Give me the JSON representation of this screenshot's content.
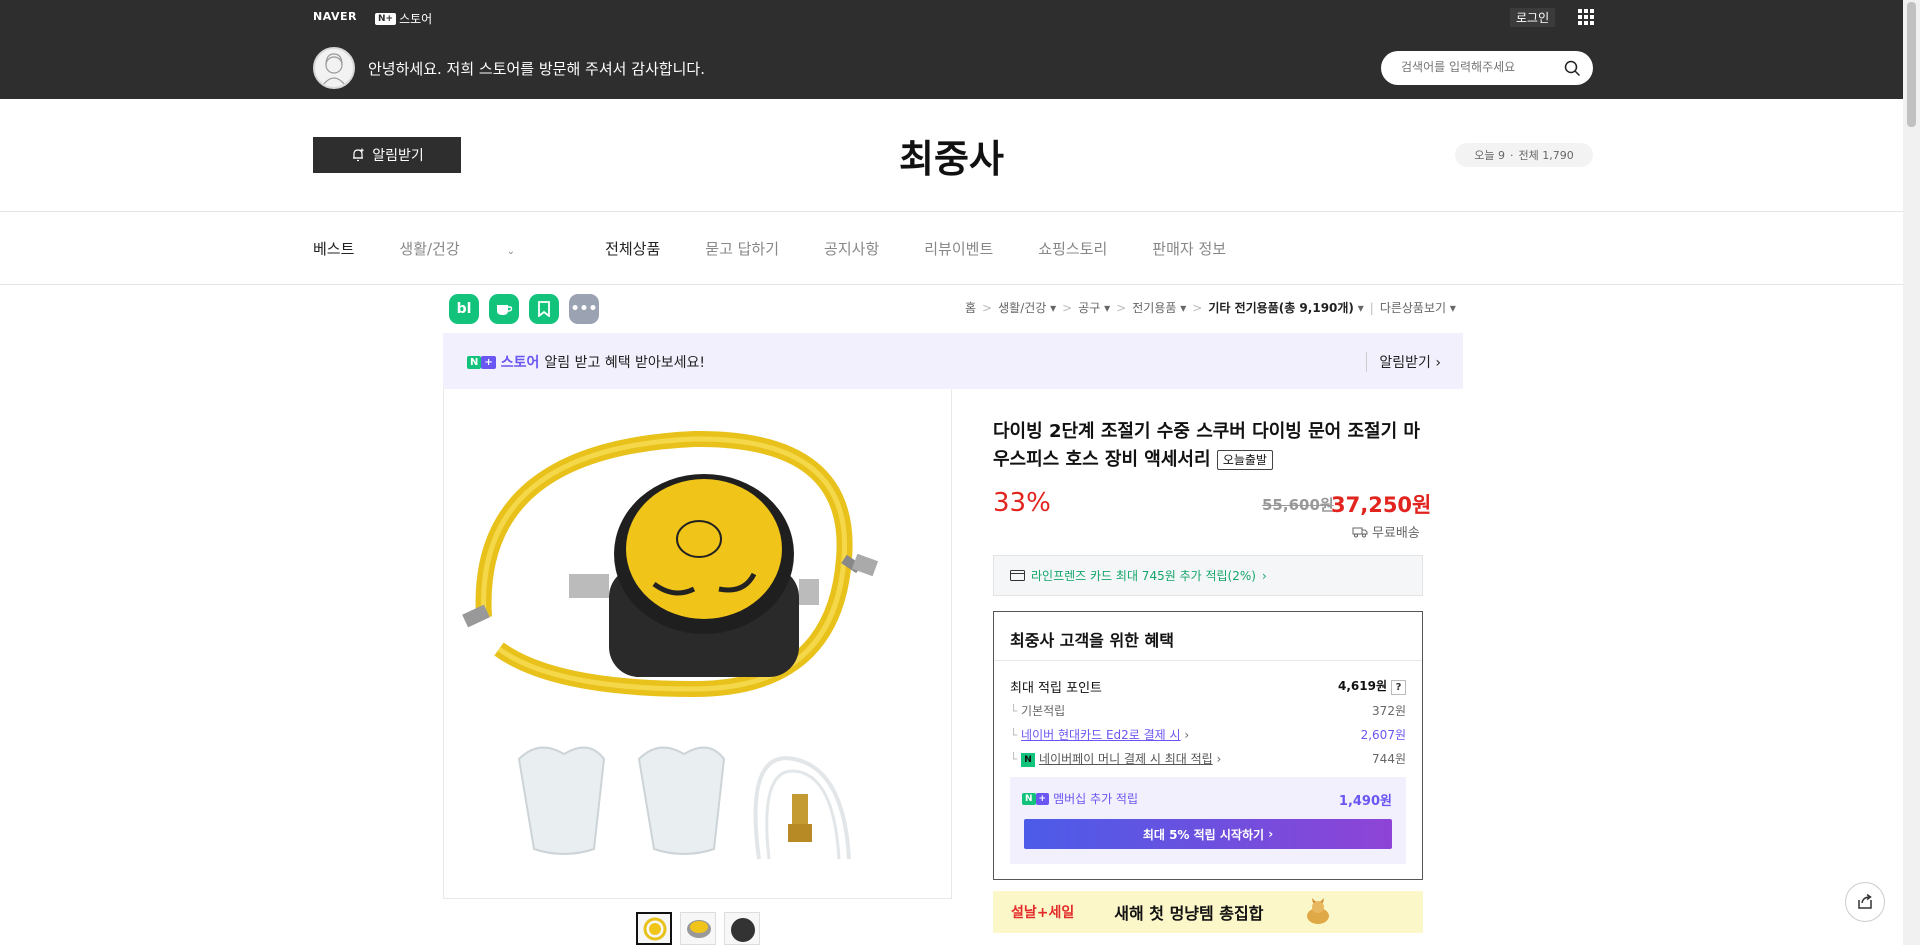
{
  "topbar": {
    "naver_logo": "NAVER",
    "nplus_box": "N+",
    "nplus_label": "스토어",
    "login": "로그인",
    "greeting": "안녕하세요. 저희 스토어를 방문해 주셔서 감사합니다.",
    "search_placeholder": "검색어를 입력해주세요"
  },
  "store": {
    "alarm_button": "알림받기",
    "title": "최중사",
    "visits_today_label": "오늘 9",
    "visits_total_label": "전체 1,790"
  },
  "nav": {
    "items": [
      {
        "label": "베스트"
      },
      {
        "label": "생활/건강"
      },
      {
        "label": "전체상품"
      },
      {
        "label": "묻고 답하기"
      },
      {
        "label": "공지사항"
      },
      {
        "label": "리뷰이벤트"
      },
      {
        "label": "쇼핑스토리"
      },
      {
        "label": "판매자 정보"
      }
    ]
  },
  "share": {
    "blog": "bl"
  },
  "breadcrumb": {
    "items": [
      "홈",
      "생활/건강",
      "공구",
      "전기용품"
    ],
    "current": "기타 전기용품(총 9,190개)",
    "other": "다른상품보기"
  },
  "promo": {
    "store_word": "스토어",
    "text": "알림 받고 혜택 받아보세요!",
    "action": "알림받기"
  },
  "product": {
    "title": "다이빙 2단계 조절기 수중 스쿠버 다이빙 문어 조절기 마우스피스 호스 장비 액세서리",
    "tag": "오늘출발",
    "discount": "33%",
    "original_price": "55,600원",
    "price": "37,250원",
    "shipping": "무료배송",
    "card_offer": "라인프렌즈 카드 최대 745원 추가 적립(2%)"
  },
  "benefits": {
    "heading": "최중사 고객을 위한 혜택",
    "max_points_label": "최대 적립 포인트",
    "max_points_value": "4,619원",
    "rows": [
      {
        "label": "기본적립",
        "value": "372원"
      },
      {
        "label": "네이버 현대카드 Ed2로 결제 시",
        "value": "2,607원"
      },
      {
        "label": "네이버페이 머니 결제 시 최대 적립",
        "value": "744원"
      }
    ],
    "membership_label": "멤버십 추가 적립",
    "membership_value": "1,490원",
    "membership_button": "최대 5% 적립 시작하기"
  },
  "sale": {
    "label": "설날+세일",
    "text": "새해 첫 멍냥템 총집합"
  },
  "colors": {
    "header_bg": "#2e2e2e",
    "price_red": "#e2241f",
    "naver_green": "#13c37c",
    "purple": "#6a56f2"
  }
}
